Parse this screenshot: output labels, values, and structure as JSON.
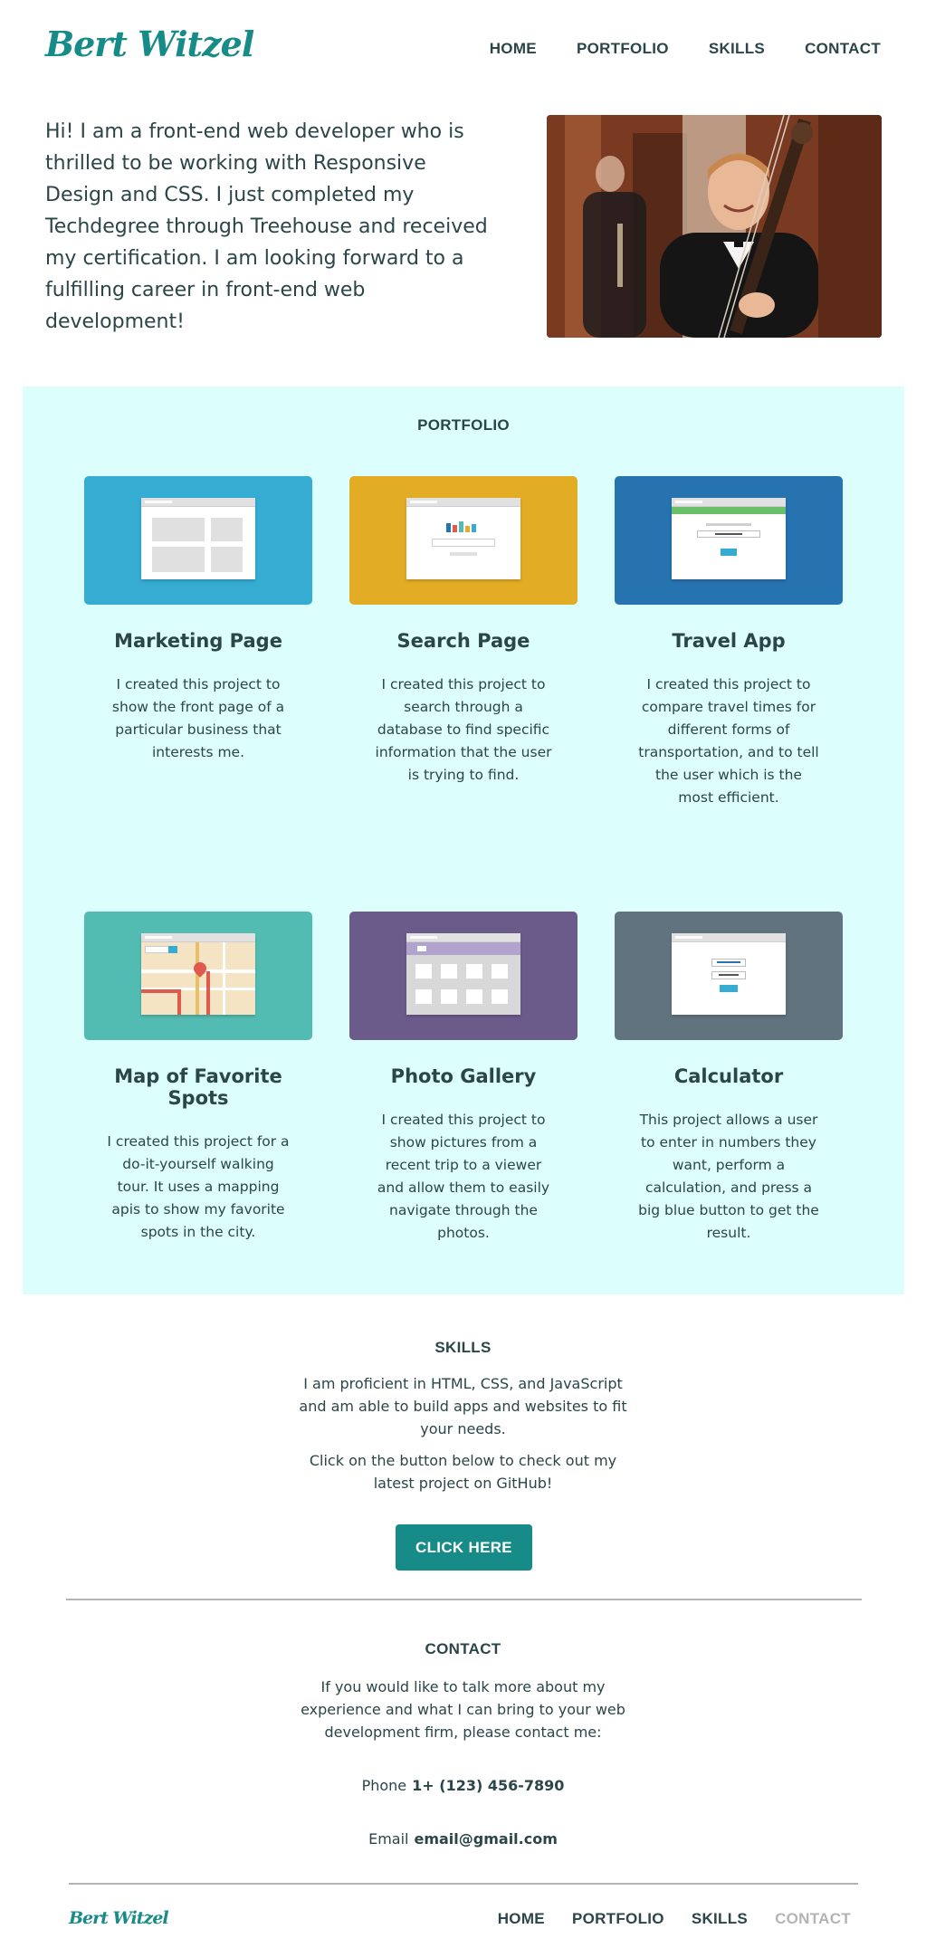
{
  "site": {
    "logo": "Bert Witzel"
  },
  "nav": [
    {
      "label": "HOME"
    },
    {
      "label": "PORTFOLIO"
    },
    {
      "label": "SKILLS"
    },
    {
      "label": "CONTACT"
    }
  ],
  "intro": {
    "text": "Hi! I am a front-end web developer who is thrilled to be working with Responsive Design and CSS. I just completed my Techdegree through Treehouse and received my certification. I am looking forward to a fulfilling career in front-end web development!"
  },
  "portfolio": {
    "title": "PORTFOLIO",
    "projects": [
      {
        "title": "Marketing Page",
        "description": "I created this project to show the front page of a particular business that interests me.",
        "color": "#36acd3"
      },
      {
        "title": "Search Page",
        "description": "I created this project to search through a database to find specific information that the user is trying to find.",
        "color": "#e2ac24"
      },
      {
        "title": "Travel App",
        "description": "I created this project to compare travel times for different forms of transportation, and to tell the user which is the most efficient.",
        "color": "#2673b0"
      },
      {
        "title": "Map of Favorite Spots",
        "description": "I created this project for a do-it-yourself walking tour. It uses a mapping apis to show my favorite spots in the city.",
        "color": "#52bcb3"
      },
      {
        "title": "Photo Gallery",
        "description": "I created this project to show pictures from a recent trip to a viewer and allow them to easily navigate through the photos.",
        "color": "#6b5b8a"
      },
      {
        "title": "Calculator",
        "description": "This project allows a user to enter in numbers they want, perform a calculation, and press a big blue button to get the result.",
        "color": "#627380"
      }
    ]
  },
  "skills": {
    "title": "SKILLS",
    "paragraph1": "I am proficient in HTML, CSS, and JavaScript and am able to build apps and websites to fit your needs.",
    "paragraph2": "Click on the button below to check out my latest project on GitHub!",
    "button_label": "CLICK HERE"
  },
  "contact": {
    "title": "CONTACT",
    "paragraph": "If you would like to talk more about my experience and what I can bring to your web development firm, please contact me:",
    "phone_label": "Phone",
    "phone_value": "1+ (123) 456-7890",
    "email_label": "Email",
    "email_value": "email@gmail.com"
  },
  "footer": {
    "logo": "Bert Witzel",
    "nav": [
      {
        "label": "HOME"
      },
      {
        "label": "PORTFOLIO"
      },
      {
        "label": "SKILLS"
      },
      {
        "label": "CONTACT",
        "active": true
      }
    ]
  },
  "colors": {
    "brand": "#168b87",
    "text": "#2b4548",
    "portfolio_bg": "#dcfffe",
    "divider": "#b4b4b4"
  }
}
